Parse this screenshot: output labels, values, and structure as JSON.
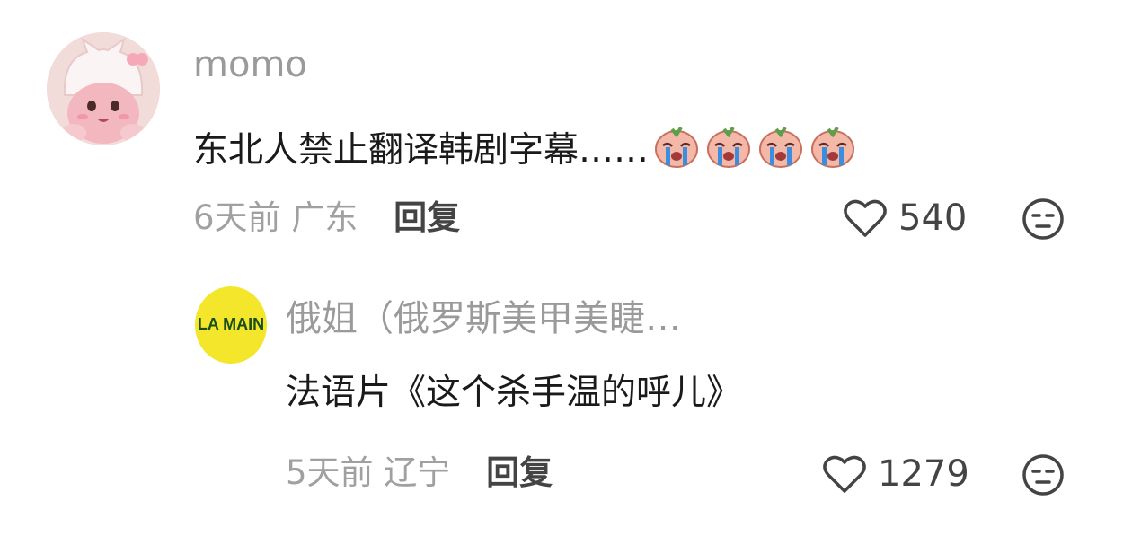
{
  "comments": [
    {
      "username": "momo",
      "avatar_icon": "pink-cat-hat-character-icon",
      "text": "东北人禁止翻译韩剧字幕……",
      "emoji_icon": "crying-peach-emoji-icon",
      "time": "6天前",
      "location": "广东",
      "reply_label": "回复",
      "likes": "540"
    },
    {
      "username": "俄姐（俄罗斯美甲美睫…",
      "avatar_text": "LA MAIN",
      "text": "法语片《这个杀手温的呼儿》",
      "time": "5天前",
      "location": "辽宁",
      "reply_label": "回复",
      "likes": "1279"
    }
  ],
  "colors": {
    "username": "#9a9a9a",
    "text": "#1a1a1a",
    "meta": "#a0a0a0",
    "reply": "#444444",
    "avatar2_bg": "#f4e62a",
    "avatar2_text": "#1a4d1a"
  }
}
